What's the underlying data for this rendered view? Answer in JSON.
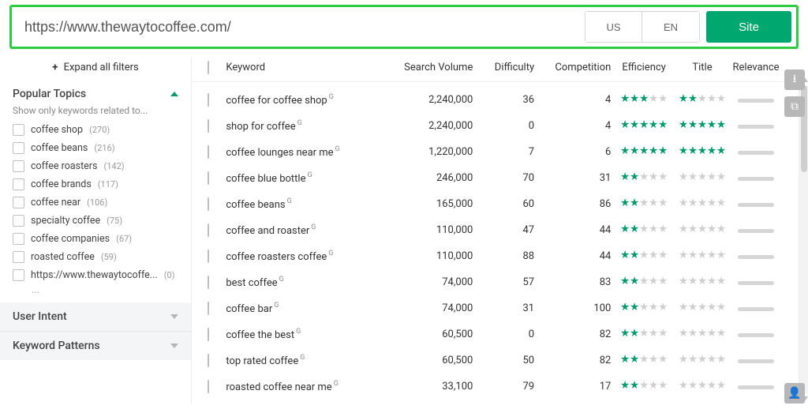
{
  "search": {
    "url": "https://www.thewaytocoffee.com/",
    "locale_country": "US",
    "locale_lang": "EN",
    "submit_label": "Site"
  },
  "sidebar": {
    "expand_all_label": "Expand all filters",
    "popular_topics": {
      "title": "Popular Topics",
      "subtitle": "Show only keywords related to...",
      "items": [
        {
          "label": "coffee shop",
          "count": "(270)"
        },
        {
          "label": "coffee beans",
          "count": "(216)"
        },
        {
          "label": "coffee roasters",
          "count": "(142)"
        },
        {
          "label": "coffee brands",
          "count": "(117)"
        },
        {
          "label": "coffee near",
          "count": "(106)"
        },
        {
          "label": "specialty coffee",
          "count": "(75)"
        },
        {
          "label": "coffee companies",
          "count": "(67)"
        },
        {
          "label": "roasted coffee",
          "count": "(59)"
        },
        {
          "label": "https://www.thewaytocoffe...",
          "count": "(0)"
        }
      ]
    },
    "user_intent_label": "User Intent",
    "keyword_patterns_label": "Keyword Patterns"
  },
  "table": {
    "headers": {
      "keyword": "Keyword",
      "search_volume": "Search Volume",
      "difficulty": "Difficulty",
      "competition": "Competition",
      "efficiency": "Efficiency",
      "title": "Title",
      "relevance": "Relevance"
    },
    "rows": [
      {
        "keyword": "coffee for coffee shop",
        "sv": "2,240,000",
        "difficulty": "36",
        "competition": "4",
        "eff": 3,
        "title": 2
      },
      {
        "keyword": "shop for coffee",
        "sv": "2,240,000",
        "difficulty": "0",
        "competition": "4",
        "eff": 5,
        "title": 5
      },
      {
        "keyword": "coffee lounges near me",
        "sv": "1,220,000",
        "difficulty": "7",
        "competition": "6",
        "eff": 5,
        "title": 5
      },
      {
        "keyword": "coffee blue bottle",
        "sv": "246,000",
        "difficulty": "70",
        "competition": "31",
        "eff": 2,
        "title": 0
      },
      {
        "keyword": "coffee beans",
        "sv": "165,000",
        "difficulty": "60",
        "competition": "86",
        "eff": 2,
        "title": 0
      },
      {
        "keyword": "coffee and roaster",
        "sv": "110,000",
        "difficulty": "47",
        "competition": "44",
        "eff": 2,
        "title": 0
      },
      {
        "keyword": "coffee roasters coffee",
        "sv": "110,000",
        "difficulty": "88",
        "competition": "44",
        "eff": 2,
        "title": 0
      },
      {
        "keyword": "best coffee",
        "sv": "74,000",
        "difficulty": "57",
        "competition": "83",
        "eff": 2,
        "title": 0
      },
      {
        "keyword": "coffee bar",
        "sv": "74,000",
        "difficulty": "31",
        "competition": "100",
        "eff": 2,
        "title": 0
      },
      {
        "keyword": "coffee the best",
        "sv": "60,500",
        "difficulty": "0",
        "competition": "82",
        "eff": 2,
        "title": 0
      },
      {
        "keyword": "top rated coffee",
        "sv": "60,500",
        "difficulty": "50",
        "competition": "82",
        "eff": 2,
        "title": 0
      },
      {
        "keyword": "roasted coffee near me",
        "sv": "33,100",
        "difficulty": "79",
        "competition": "17",
        "eff": 2,
        "title": 0
      }
    ]
  },
  "icons": {
    "download": "download-icon",
    "copy": "copy-icon",
    "user": "user-icon"
  }
}
